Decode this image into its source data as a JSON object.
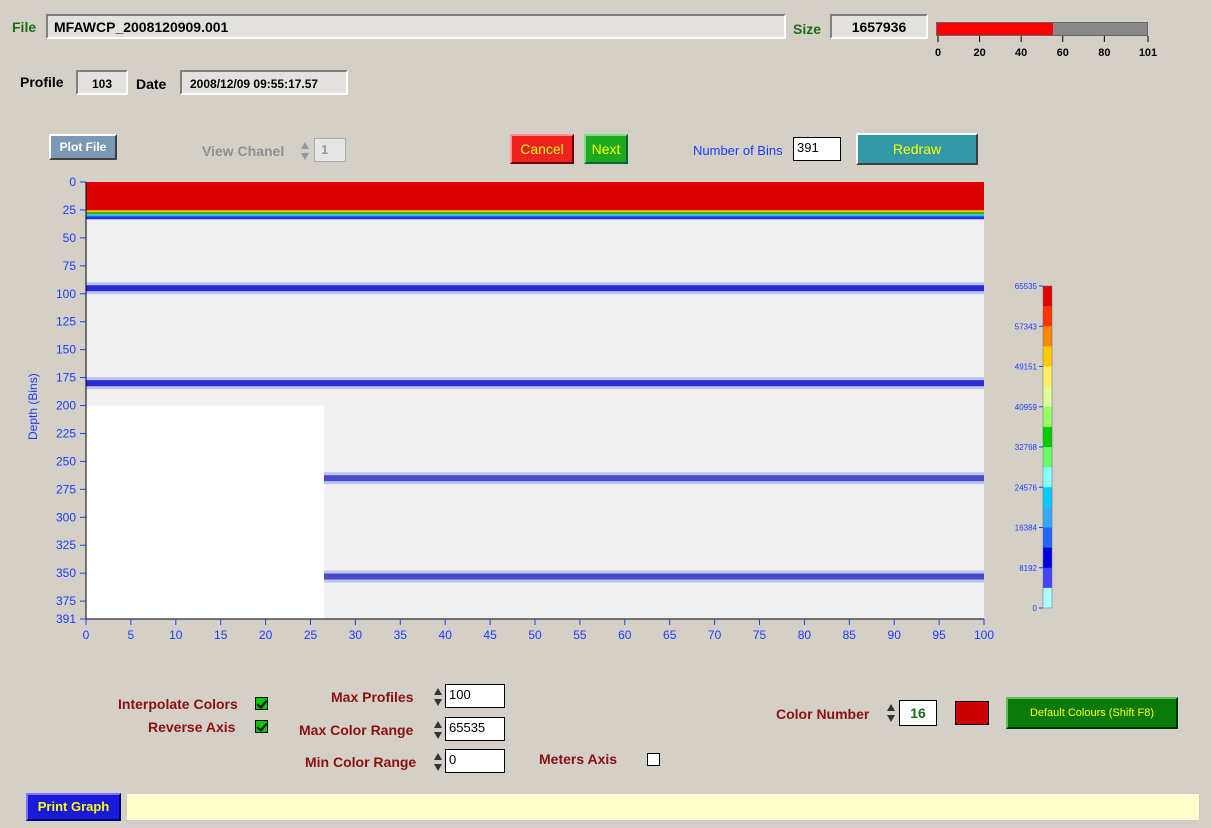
{
  "header": {
    "file_label": "File",
    "file_value": "MFAWCP_2008120909.001",
    "size_label": "Size",
    "size_value": "1657936",
    "progress": {
      "value": 56,
      "max": 101,
      "fill_color": "#ff0000",
      "ticks": [
        "0",
        "20",
        "40",
        "60",
        "80",
        "101"
      ]
    },
    "profile_label": "Profile",
    "profile_value": "103",
    "date_label": "Date",
    "date_value": "2008/12/09 09:55:17.57"
  },
  "toolbar": {
    "plot_file": "Plot File",
    "view_channel_label": "View Chanel",
    "view_channel_value": "1",
    "cancel": "Cancel",
    "next": "Next",
    "bins_label": "Number of Bins",
    "bins_value": "391",
    "redraw": "Redraw"
  },
  "chart_data": {
    "type": "heatmap",
    "ylabel": "Depth (Bins)",
    "xlabel": "",
    "xlim": [
      0,
      100
    ],
    "ylim": [
      0,
      391
    ],
    "reverse_y": true,
    "x_ticks": [
      "0",
      "5",
      "10",
      "15",
      "20",
      "25",
      "30",
      "35",
      "40",
      "45",
      "50",
      "55",
      "60",
      "65",
      "70",
      "75",
      "80",
      "85",
      "90",
      "95",
      "100"
    ],
    "y_ticks": [
      "0",
      "25",
      "50",
      "75",
      "100",
      "125",
      "150",
      "175",
      "200",
      "225",
      "250",
      "275",
      "300",
      "325",
      "350",
      "375",
      "391"
    ],
    "surface_band": {
      "from_bin": 0,
      "to_bin": 28,
      "color": "#dd0000"
    },
    "blank_region": {
      "x_from": 0,
      "x_to": 26.5,
      "from_bin": 200,
      "to_bin": 391
    },
    "echo_bands": [
      {
        "depth_bin": 95,
        "x_from": 0,
        "x_to": 100
      },
      {
        "depth_bin": 180,
        "x_from": 0,
        "x_to": 100
      },
      {
        "depth_bin": 265,
        "x_from": 26.5,
        "x_to": 100
      },
      {
        "depth_bin": 353,
        "x_from": 26.5,
        "x_to": 100
      }
    ],
    "colorscale": {
      "labels": [
        "65535",
        "57343",
        "49151",
        "40959",
        "32768",
        "24576",
        "16384",
        "8192",
        "0"
      ],
      "colors": [
        "#e00000",
        "#ff3300",
        "#ff8800",
        "#ffcc00",
        "#ffee66",
        "#ddff99",
        "#99ff66",
        "#00cc00",
        "#66ff66",
        "#88ffff",
        "#00ccff",
        "#33aaff",
        "#2266ff",
        "#0000dd",
        "#4444ff",
        "#aaffff"
      ]
    }
  },
  "settings": {
    "interpolate_label": "Interpolate Colors",
    "interpolate_checked": true,
    "reverse_label": "Reverse Axis",
    "reverse_checked": true,
    "max_profiles_label": "Max Profiles",
    "max_profiles_value": "100",
    "max_color_label": "Max Color Range",
    "max_color_value": "65535",
    "min_color_label": "Min Color Range",
    "min_color_value": "0",
    "meters_label": "Meters Axis",
    "meters_checked": false,
    "color_number_label": "Color Number",
    "color_number_value": "16",
    "color_swatch": "#cc0000",
    "default_colours": "Default Colours (Shift F8)"
  },
  "footer": {
    "print_graph": "Print Graph",
    "status_text": ""
  }
}
